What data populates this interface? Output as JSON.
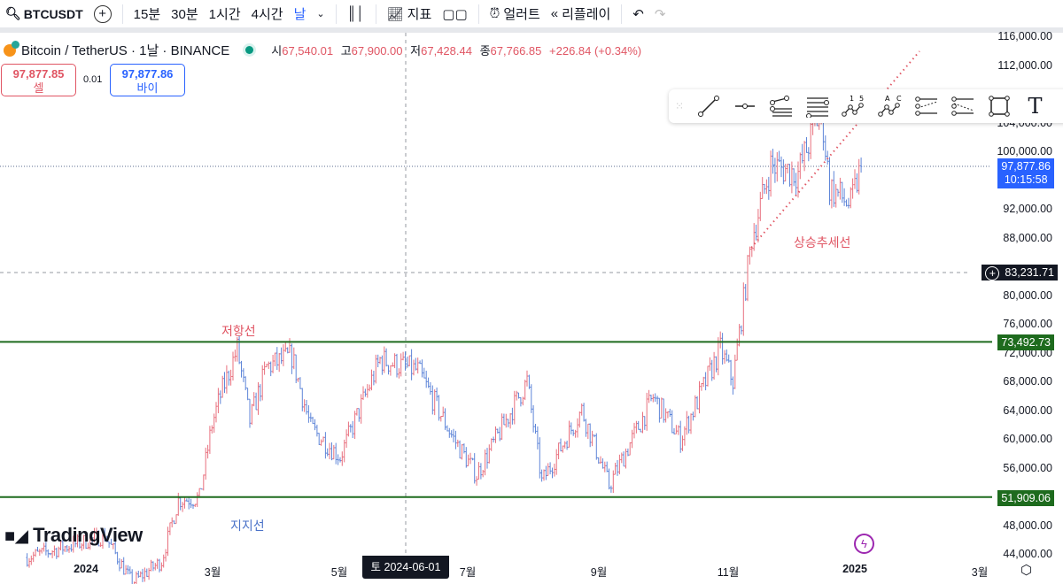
{
  "toolbar": {
    "symbol": "BTCUSDT",
    "intervals": [
      "15분",
      "30분",
      "1시간",
      "4시간",
      "날"
    ],
    "active_interval": "날",
    "indicators": "지표",
    "alert": "얼러트",
    "replay": "리플레이"
  },
  "legend": {
    "title": "Bitcoin / TetherUS · 1날 · BINANCE",
    "o_label": "시",
    "o": "67,540.01",
    "h_label": "고",
    "h": "67,900.00",
    "l_label": "저",
    "l": "67,428.44",
    "c_label": "종",
    "c": "67,766.85",
    "change": "+226.84 (+0.34%)"
  },
  "trade": {
    "sell_price": "97,877.85",
    "sell_label": "셀",
    "spread": "0.01",
    "buy_price": "97,877.86",
    "buy_label": "바이"
  },
  "price_axis": {
    "ticks": [
      "116,000.00",
      "112,000.00",
      "104,000.00",
      "100,000.00",
      "92,000.00",
      "88,000.00",
      "80,000.00",
      "76,000.00",
      "72,000.00",
      "68,000.00",
      "64,000.00",
      "60,000.00",
      "56,000.00",
      "48,000.00",
      "44,000.00"
    ],
    "current_price": "97,877.86",
    "countdown": "10:15:58",
    "crosshair_price": "83,231.71",
    "resistance_price": "73,492.73",
    "support_price": "51,909.06"
  },
  "time_axis": {
    "labels": [
      "2024",
      "3월",
      "5월",
      "7월",
      "9월",
      "11월",
      "2025",
      "3월"
    ],
    "crosshair_date": "토 2024-06-01"
  },
  "annotations": {
    "resistance": "저항선",
    "support": "지지선",
    "trendline": "상승추세선"
  },
  "logo": "TradingView",
  "colors": {
    "up": "#e8707e",
    "down": "#5f86d8",
    "level_line": "#1e6b1e",
    "accent": "#2962ff"
  },
  "chart_data": {
    "type": "ohlc",
    "approx_close_path": [
      [
        "2023-12-04",
        43500
      ],
      [
        "2024-01-10",
        46500
      ],
      [
        "2024-01-23",
        40000
      ],
      [
        "2024-02-06",
        43000
      ],
      [
        "2024-02-14",
        51500
      ],
      [
        "2024-02-24",
        51800
      ],
      [
        "2024-03-01",
        62000
      ],
      [
        "2024-03-05",
        66000
      ],
      [
        "2024-03-13",
        72500
      ],
      [
        "2024-03-19",
        62500
      ],
      [
        "2024-03-27",
        70000
      ],
      [
        "2024-04-08",
        71500
      ],
      [
        "2024-04-17",
        61500
      ],
      [
        "2024-05-01",
        57500
      ],
      [
        "2024-05-20",
        71000
      ],
      [
        "2024-06-07",
        69500
      ],
      [
        "2024-06-24",
        60000
      ],
      [
        "2024-07-05",
        55000
      ],
      [
        "2024-07-29",
        68000
      ],
      [
        "2024-08-05",
        54000
      ],
      [
        "2024-08-24",
        64000
      ],
      [
        "2024-09-06",
        53500
      ],
      [
        "2024-09-27",
        65800
      ],
      [
        "2024-10-10",
        60000
      ],
      [
        "2024-10-29",
        72500
      ],
      [
        "2024-11-04",
        68000
      ],
      [
        "2024-11-13",
        88000
      ],
      [
        "2024-11-22",
        98000
      ],
      [
        "2024-12-05",
        97000
      ],
      [
        "2024-12-16",
        106000
      ],
      [
        "2024-12-20",
        95000
      ],
      [
        "2024-12-30",
        92500
      ],
      [
        "2025-01-04",
        97877.86
      ]
    ]
  }
}
